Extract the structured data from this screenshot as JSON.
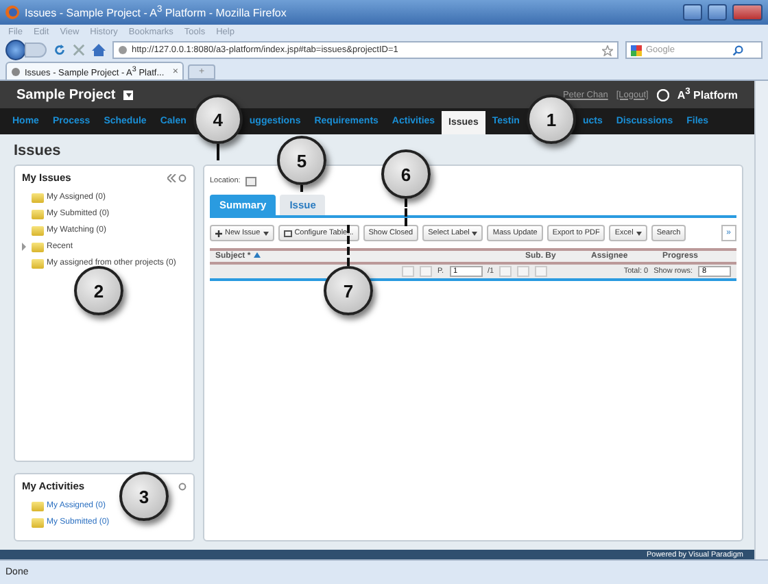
{
  "window": {
    "title": "Issues - Sample Project - A$^{3}$ Platform - Mozilla Firefox"
  },
  "menu": [
    "File",
    "Edit",
    "View",
    "History",
    "Bookmarks",
    "Tools",
    "Help"
  ],
  "address": {
    "value": "http://127.0.0.1:8080/a3-platform/index.jsp#tab=issues&projectID=1"
  },
  "search": {
    "placeholder": "Google"
  },
  "browser_tabs": [
    {
      "label": "Issues - Sample Project - A$^{3}$ Platf...",
      "close": "×",
      "selected": true
    }
  ],
  "new_tab": "+",
  "app": {
    "project": "Sample Project",
    "user": "Peter Chan",
    "logout": "[Logout]",
    "logo": "A$^{3}$ Platform"
  },
  "nav": [
    {
      "kind": "link",
      "label": "Home",
      "selected": false
    },
    {
      "kind": "link",
      "label": "Process",
      "selected": false
    },
    {
      "kind": "link",
      "label": "Schedule",
      "selected": false
    },
    {
      "kind": "link",
      "label": "Calen",
      "selected": false
    },
    {
      "kind": "callout",
      "number": "4"
    },
    {
      "kind": "link",
      "label": "uggestions",
      "selected": false
    },
    {
      "kind": "link",
      "label": "Requirements",
      "selected": false
    },
    {
      "kind": "link",
      "label": "Activities",
      "selected": false
    },
    {
      "kind": "link",
      "label": "Issues",
      "selected": true
    },
    {
      "kind": "link",
      "label": "Testin",
      "selected": false
    },
    {
      "kind": "callout",
      "number": "1"
    },
    {
      "kind": "link",
      "label": "ucts",
      "selected": false
    },
    {
      "kind": "link",
      "label": "Discussions",
      "selected": false
    },
    {
      "kind": "link",
      "label": "Files",
      "selected": false
    }
  ],
  "page_title": "Issues",
  "my_issues": {
    "title": "My Issues",
    "items": [
      {
        "label": "My Assigned (0)",
        "expandable": false
      },
      {
        "label": "My Submitted (0)",
        "expandable": false
      },
      {
        "label": "My Watching (0)",
        "expandable": false
      },
      {
        "label": "Recent",
        "expandable": true
      },
      {
        "label": "My assigned from other projects (0)",
        "expandable": false
      }
    ]
  },
  "my_activities": {
    "title": "My Activities",
    "items": [
      "My Assigned (0)",
      "My Submitted (0)"
    ]
  },
  "main": {
    "location_label": "Location:",
    "tabs": [
      {
        "label": "Summary",
        "selected": true
      },
      {
        "label": "Issue",
        "selected": false
      }
    ],
    "toolbar": [
      {
        "label": "New Issue",
        "kind": "add"
      },
      {
        "label": "Configure Table...",
        "kind": "configure"
      },
      {
        "label": "Show Closed",
        "kind": "plain"
      },
      {
        "label": "Select Label",
        "kind": "menu"
      },
      {
        "label": "Mass Update",
        "kind": "plain"
      },
      {
        "label": "Export to PDF",
        "kind": "plain"
      },
      {
        "label": "Excel",
        "kind": "menu"
      },
      {
        "label": "Search",
        "kind": "plain"
      }
    ],
    "more": "»",
    "columns": [
      "Subject *",
      "Sub. By",
      "Assignee",
      "Progress"
    ],
    "pager": {
      "page_label": "P.",
      "page": "1",
      "of": "/1",
      "total": "Total: 0",
      "rows_label": "Show rows:",
      "rows": "8"
    }
  },
  "callouts": [
    "5",
    "6",
    "2",
    "7",
    "3"
  ],
  "footer": "Powered by Visual Paradigm",
  "status": "Done"
}
